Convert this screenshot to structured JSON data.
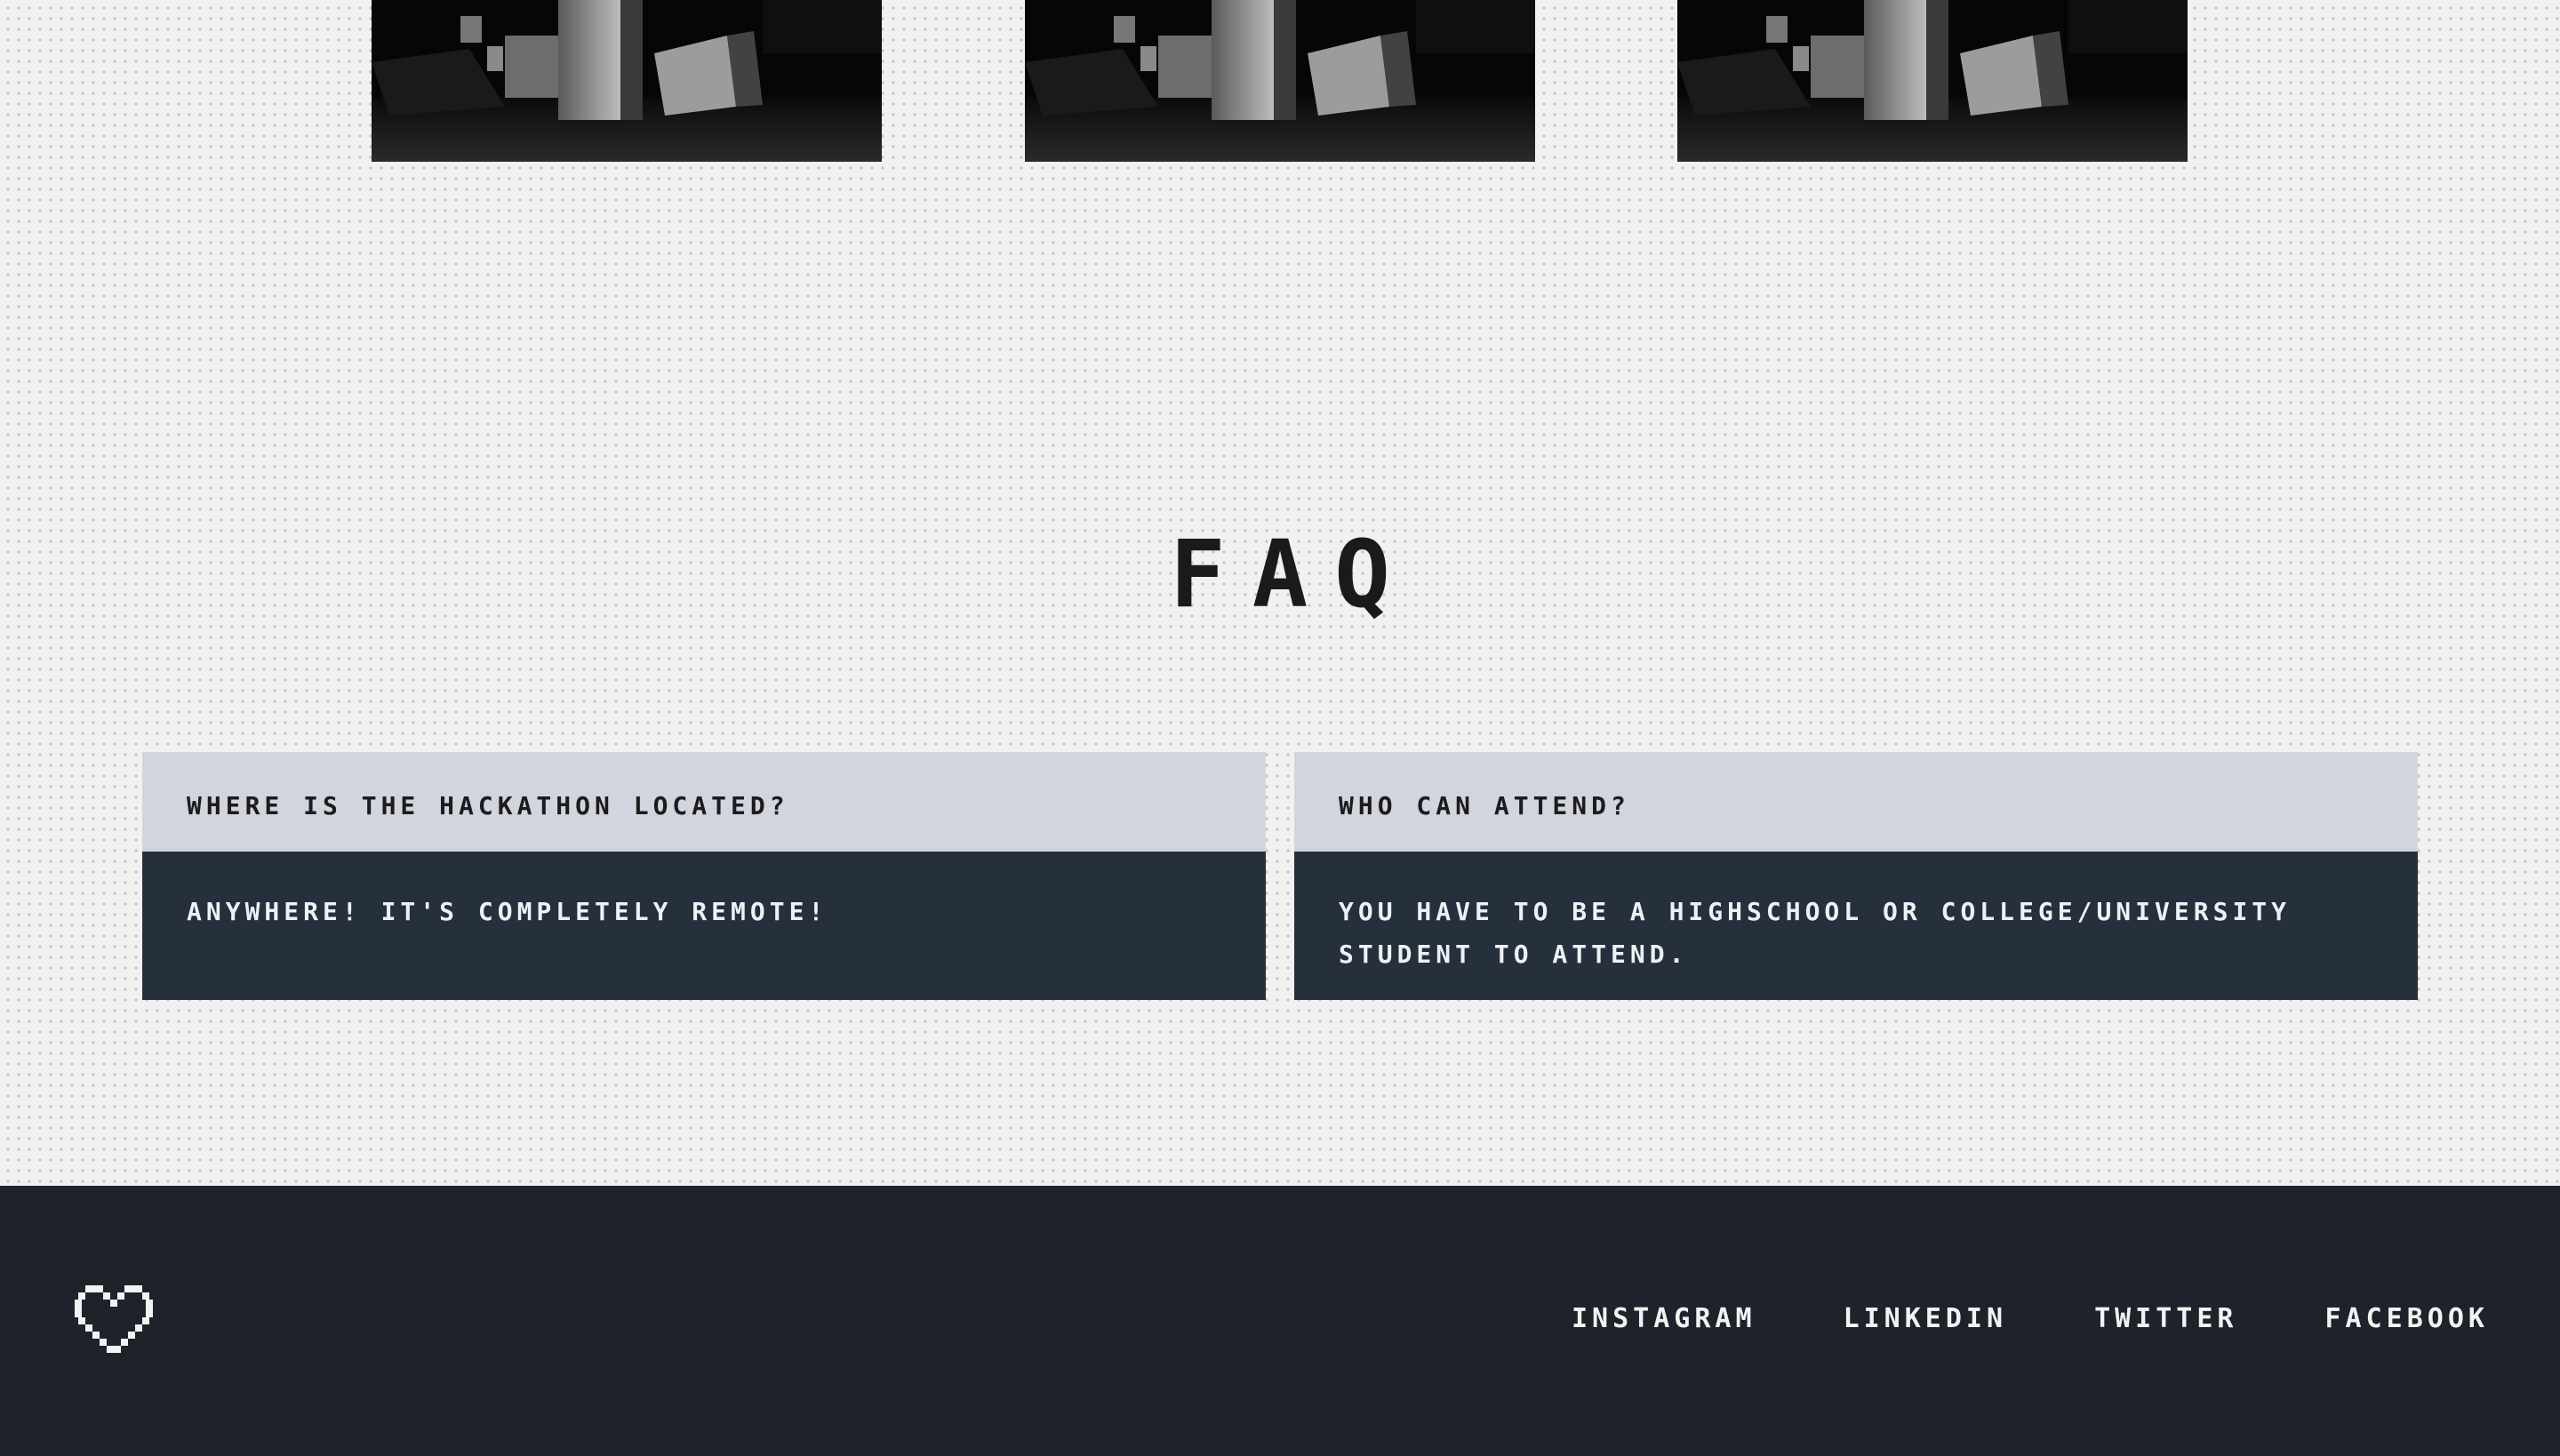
{
  "gallery": {
    "images": [
      {
        "name": "gallery-image-1"
      },
      {
        "name": "gallery-image-2"
      },
      {
        "name": "gallery-image-3"
      }
    ]
  },
  "faq": {
    "title": "FAQ",
    "items": [
      {
        "question": "Where is the hackathon located?",
        "answer": "Anywhere! It's completely remote!"
      },
      {
        "question": "Who can attend?",
        "answer": "You have to be a highschool or college/university student to attend."
      }
    ]
  },
  "footer": {
    "logo_icon": "heart-icon",
    "links": [
      "Instagram",
      "LinkedIn",
      "Twitter",
      "Facebook"
    ]
  },
  "colors": {
    "page_background": "#f1f1f1",
    "question_background": "#d2d4de",
    "answer_background": "#26303d",
    "footer_background": "#1e222a"
  }
}
